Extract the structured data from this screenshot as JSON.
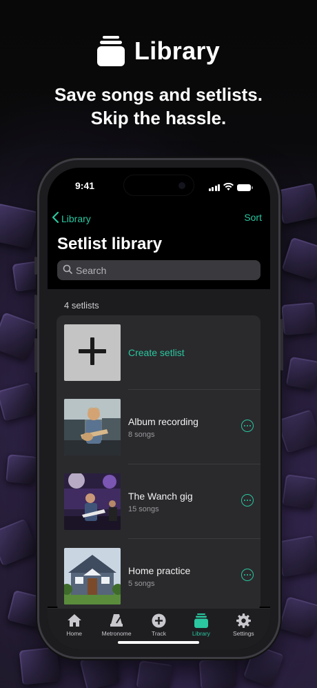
{
  "hero": {
    "title": "Library",
    "subtitle_line1": "Save songs and setlists.",
    "subtitle_line2": "Skip the hassle."
  },
  "status_bar": {
    "time": "9:41"
  },
  "nav": {
    "back_label": "Library",
    "sort_label": "Sort"
  },
  "page": {
    "title": "Setlist library",
    "search_placeholder": "Search",
    "count_label": "4 setlists"
  },
  "create_row": {
    "label": "Create setlist"
  },
  "setlists": [
    {
      "title": "Album recording",
      "subtitle": "8 songs",
      "thumb": "guitarist-studio"
    },
    {
      "title": "The Wanch gig",
      "subtitle": "15 songs",
      "thumb": "band-stage"
    },
    {
      "title": "Home practice",
      "subtitle": "5 songs",
      "thumb": "house"
    }
  ],
  "tabs": [
    {
      "label": "Home",
      "icon": "home-icon"
    },
    {
      "label": "Metronome",
      "icon": "metronome-icon"
    },
    {
      "label": "Track",
      "icon": "plus-circle-icon"
    },
    {
      "label": "Library",
      "icon": "library-icon",
      "active": true
    },
    {
      "label": "Settings",
      "icon": "gear-icon"
    }
  ],
  "colors": {
    "accent": "#2ac7a0",
    "background": "#000000",
    "card": "#2a2a2d"
  }
}
